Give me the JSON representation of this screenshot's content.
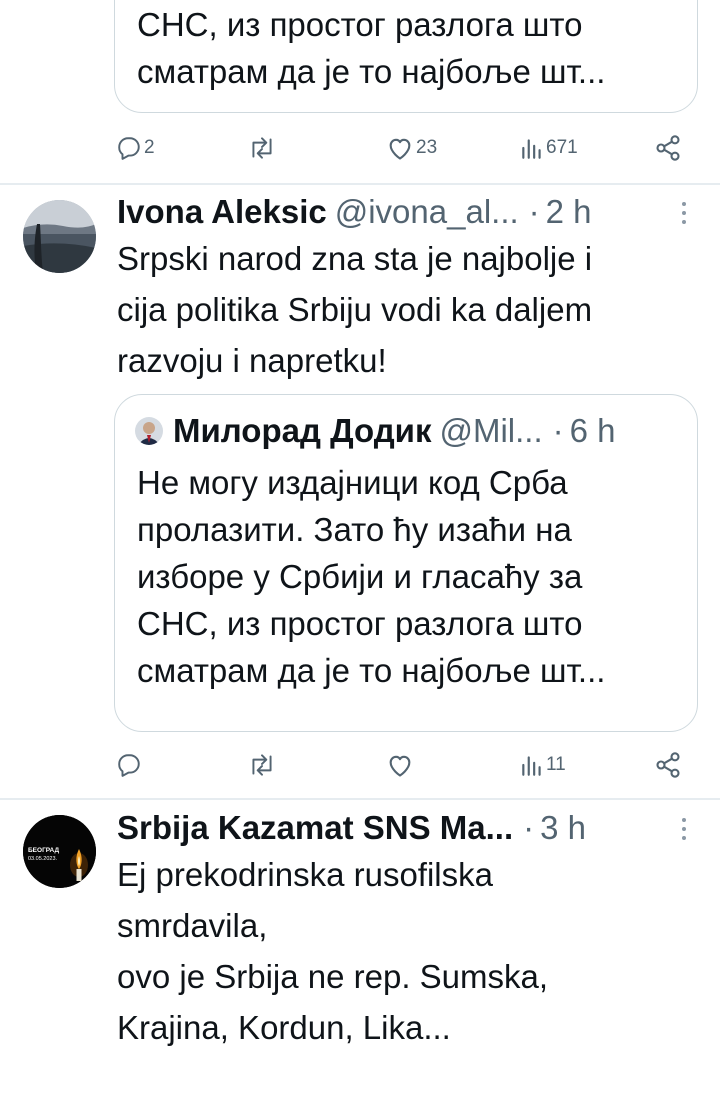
{
  "tweet_top": {
    "quote_lines": [
      "СНС, из простог разлога што",
      "сматрам да је то најбоље шт..."
    ],
    "actions": {
      "replies": "2",
      "retweets": "",
      "likes": "23",
      "views": "671"
    }
  },
  "tweet_ivona": {
    "author": "Ivona Aleksic",
    "handle": "@ivona_al...",
    "separator": "·",
    "time": "2 h",
    "text_lines": [
      "Srpski narod zna sta je najbolje i",
      "cija politika Srbiju vodi ka daljem",
      "razvoju i napretku!"
    ],
    "quote": {
      "author": "Милорад Додик",
      "handle": "@Mil...",
      "separator": "·",
      "time": "6 h",
      "text_lines": [
        "Не могу издајници код Срба",
        "пролазити. Зато ћу изаћи на",
        "изборе у Србији и гласаћу за",
        "СНС, из простог разлога што",
        "сматрам да је то најбоље шт..."
      ]
    },
    "actions": {
      "replies": "",
      "retweets": "",
      "likes": "",
      "views": "11"
    }
  },
  "tweet_srbija": {
    "author": "Srbija Kazamat SNS Ma...",
    "separator": "·",
    "time": "3 h",
    "avatar_text_line1": "БЕОГРАД",
    "avatar_text_line2": "03.05.2023.",
    "text_lines": [
      "Ej prekodrinska rusofilska",
      "smrdavila,",
      "ovo je Srbija ne rep. Sumska,",
      "Krajina, Kordun, Lika..."
    ]
  },
  "icons": {
    "reply": "speech-bubble-icon",
    "retweet": "retweet-arrows-icon",
    "like": "heart-icon",
    "views": "bar-chart-icon",
    "share": "share-nodes-icon",
    "more": "vertical-dots-icon"
  },
  "colors": {
    "text": "#0f1419",
    "secondary": "#536471",
    "border": "#cfd9de"
  }
}
